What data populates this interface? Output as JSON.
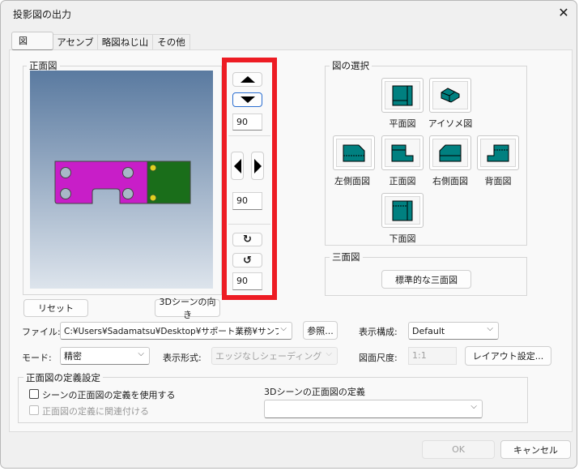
{
  "window": {
    "title": "投影図の出力",
    "close_icon": "close-icon"
  },
  "tabs": [
    {
      "label": "図",
      "selected": true
    },
    {
      "label": "アセンブリ"
    },
    {
      "label": "略図ねじ山"
    },
    {
      "label": "その他"
    }
  ],
  "front_view": {
    "label": "正面図",
    "reset": "リセット",
    "scene_orientation": "3Dシーンの向き",
    "part_colors": {
      "body": "#c81ec8",
      "side": "#1a6e1a",
      "bg_top": "#5a7aa0",
      "bg_bottom": "#dde4ec"
    }
  },
  "rotation": {
    "vertical_angle": "90",
    "horizontal_angle": "90",
    "roll_angle": "90",
    "highlight_color": "#ed1c24"
  },
  "view_select": {
    "label": "図の選択",
    "views": [
      {
        "label": "平面図",
        "icon": "top-view-icon"
      },
      {
        "label": "アイソメ図",
        "icon": "isometric-view-icon"
      },
      {
        "label": "左側面図",
        "icon": "left-view-icon"
      },
      {
        "label": "正面図",
        "icon": "front-view-icon"
      },
      {
        "label": "右側面図",
        "icon": "right-view-icon"
      },
      {
        "label": "背面図",
        "icon": "back-view-icon"
      },
      {
        "label": "下面図",
        "icon": "bottom-view-icon"
      }
    ],
    "icon_color": "#008080"
  },
  "three_view": {
    "label": "三面図",
    "button": "標準的な三面図"
  },
  "file": {
    "label": "ファイル:",
    "value": "C:¥Users¥Sadamatsu¥Desktop¥サポート業務¥サンプル",
    "browse": "参照..."
  },
  "display_config": {
    "label": "表示構成:",
    "value": "Default"
  },
  "mode": {
    "label": "モード:",
    "value": "精密"
  },
  "display_style": {
    "label": "表示形式:",
    "value": "エッジなしシェーディング",
    "disabled": true
  },
  "scale": {
    "label": "図面尺度:",
    "value": "1:1",
    "disabled": true
  },
  "layout_button": "レイアウト設定...",
  "front_def": {
    "label": "正面図の定義設定",
    "use_scene": "シーンの正面図の定義を使用する",
    "link_def": "正面図の定義に関連付ける",
    "scene_def_label": "3Dシーンの正面図の定義",
    "scene_def_value": ""
  },
  "footer": {
    "ok": "OK",
    "cancel": "キャンセル"
  }
}
